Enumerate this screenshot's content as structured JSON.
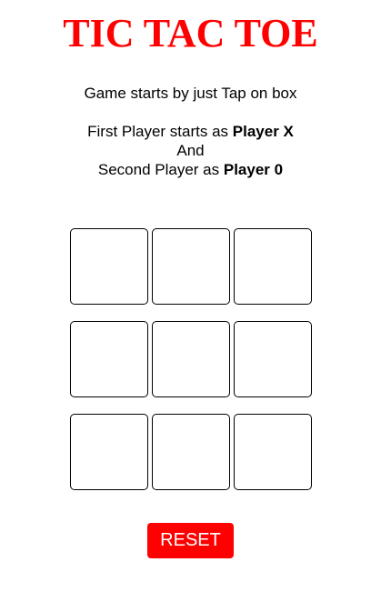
{
  "title": "TIC TAC TOE",
  "instructions": {
    "start": "Game starts by just Tap on box",
    "first_prefix": "First Player starts as ",
    "first_player": "Player X",
    "and": "And",
    "second_prefix": "Second Player as ",
    "second_player": "Player 0"
  },
  "board": {
    "cells": [
      "",
      "",
      "",
      "",
      "",
      "",
      "",
      "",
      ""
    ]
  },
  "reset_label": "RESET",
  "colors": {
    "title": "#ff0000",
    "reset_background": "#ff0000",
    "reset_text": "#ffffff",
    "cell_border": "#000000"
  }
}
